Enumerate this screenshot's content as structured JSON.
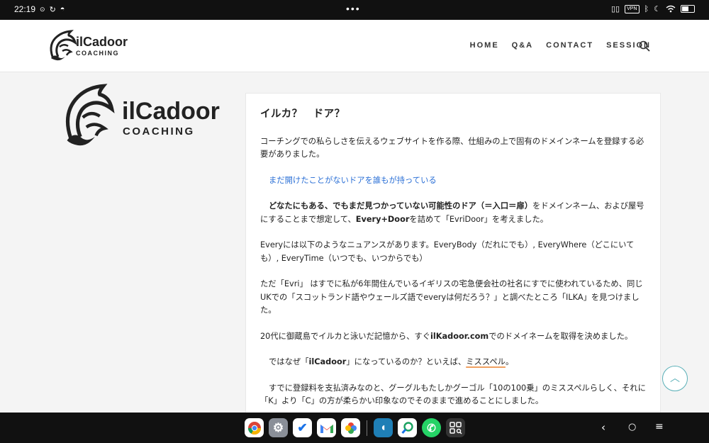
{
  "status_bar": {
    "time": "22:19",
    "vpn": "VPN",
    "battery_level": 0.55
  },
  "header": {
    "brand": "ilCadoor",
    "sub": "COACHING",
    "nav": [
      "HOME",
      "Q&A",
      "CONTACT",
      "SESSION"
    ]
  },
  "sidebar_logo": {
    "brand": "ilCadoor",
    "sub": "COACHING"
  },
  "article": {
    "title": "イルカ？　ドア？",
    "p1": "コーチングでの私らしさを伝えるウェブサイトを作る際、仕組みの上で固有のドメインネームを登録する必要がありました。",
    "link": "まだ開けたことがないドアを誰もが持っている",
    "p3_bold": "どなたにもある、でもまだ見つかっていない可能性のドア（＝入口＝扉）",
    "p3_rest_a": "をドメインネーム、および屋号にすることまで想定して、",
    "p3_bold2": "Every+Door",
    "p3_rest_b": "を詰めて「EvriDoor」を考えました。",
    "p4": "Everyには以下のようなニュアンスがあります。EveryBody（だれにでも）, EveryWhere（どこにいても）, EveryTime（いつでも、いつからでも）",
    "p5": "ただ「Evri」 はすでに私が6年間住んでいるイギリスの宅急便会社の社名にすでに使われているため、同じUKでの「スコットランド語やウェールズ語でeveryは何だろう？」と調べたところ「ILKA」を見つけました。",
    "p6_a": "20代に御蔵島でイルカと泳いだ記憶から、すぐ",
    "p6_bold": "ilKadoor.com",
    "p6_b": "でのドメイネームを取得を決めました。",
    "p7_a": "ではなぜ「",
    "p7_bold": "ilCadoor",
    "p7_b": "」になっているのか？といえば、",
    "p7_u": "ミススペル",
    "p7_c": "。",
    "p8": "すでに登録料を支払済みなのと、グーグルもたしかグーゴル「10の100乗」のミススペルらしく、それに「K」より「C」の方が柔らかい印象なのでそのままで進めることにしました。"
  },
  "colors": {
    "link": "#2a6fd6",
    "accent_teal": "#5ab0b8",
    "underline": "#f0a060"
  },
  "dock_apps": [
    "chrome-icon",
    "settings-icon",
    "tasks-icon",
    "gmail-icon",
    "photos-icon",
    "dolphin-app-icon",
    "search-app-icon",
    "whatsapp-icon",
    "app-drawer-icon"
  ]
}
